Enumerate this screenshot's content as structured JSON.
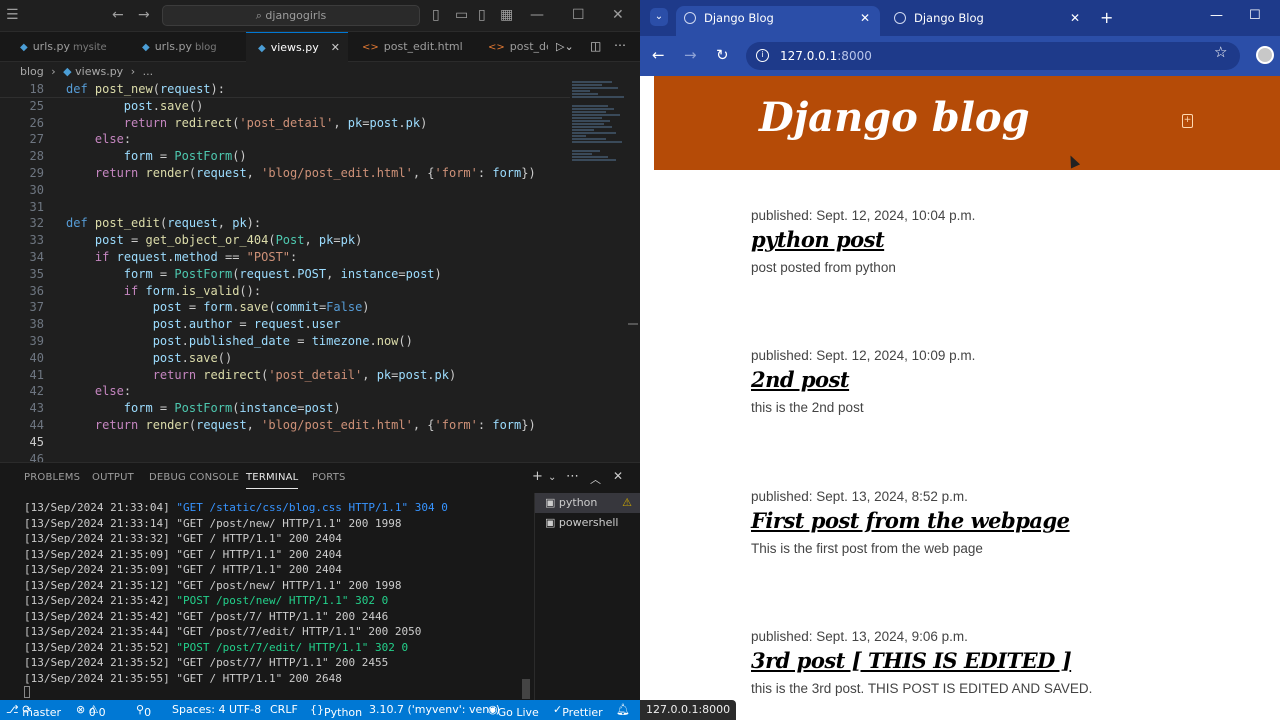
{
  "vscode": {
    "search_text": "djangogirls",
    "tabs": [
      {
        "label": "urls.py",
        "desc": "mysite",
        "type": "py"
      },
      {
        "label": "urls.py",
        "desc": "blog",
        "type": "py"
      },
      {
        "label": "views.py",
        "desc": "",
        "type": "py",
        "active": true
      },
      {
        "label": "post_edit.html",
        "desc": "",
        "type": "html"
      },
      {
        "label": "post_deta",
        "desc": "",
        "type": "html"
      }
    ],
    "breadcrumb": [
      "blog",
      "views.py",
      "..."
    ],
    "code": [
      {
        "n": "18",
        "html": "<span class=\"kw\">def</span> <span class=\"fn\">post_new</span>(<span class=\"var\">request</span>):"
      },
      {
        "n": "25",
        "html": "        <span class=\"var\">post</span>.<span class=\"fn\">save</span>()"
      },
      {
        "n": "26",
        "html": "        <span class=\"ctrl\">return</span> <span class=\"fn\">redirect</span>(<span class=\"str\">'post_detail'</span>, <span class=\"var\">pk</span>=<span class=\"var\">post</span>.<span class=\"var\">pk</span>)"
      },
      {
        "n": "27",
        "html": "    <span class=\"ctrl\">else</span>:"
      },
      {
        "n": "28",
        "html": "        <span class=\"var\">form</span> = <span class=\"cls\">PostForm</span>()"
      },
      {
        "n": "29",
        "html": "    <span class=\"ctrl\">return</span> <span class=\"fn\">render</span>(<span class=\"var\">request</span>, <span class=\"str\">'blog/post_edit.html'</span>, {<span class=\"str\">'form'</span>: <span class=\"var\">form</span>})"
      },
      {
        "n": "30",
        "html": ""
      },
      {
        "n": "31",
        "html": ""
      },
      {
        "n": "32",
        "html": "<span class=\"kw\">def</span> <span class=\"fn\">post_edit</span>(<span class=\"var\">request</span>, <span class=\"var\">pk</span>):"
      },
      {
        "n": "33",
        "html": "    <span class=\"var\">post</span> = <span class=\"fn\">get_object_or_404</span>(<span class=\"cls\">Post</span>, <span class=\"var\">pk</span>=<span class=\"var\">pk</span>)"
      },
      {
        "n": "34",
        "html": "    <span class=\"ctrl\">if</span> <span class=\"var\">request</span>.<span class=\"var\">method</span> == <span class=\"str\">\"POST\"</span>:"
      },
      {
        "n": "35",
        "html": "        <span class=\"var\">form</span> = <span class=\"cls\">PostForm</span>(<span class=\"var\">request</span>.<span class=\"var\">POST</span>, <span class=\"var\">instance</span>=<span class=\"var\">post</span>)"
      },
      {
        "n": "36",
        "html": "        <span class=\"ctrl\">if</span> <span class=\"var\">form</span>.<span class=\"fn\">is_valid</span>():"
      },
      {
        "n": "37",
        "html": "            <span class=\"var\">post</span> = <span class=\"var\">form</span>.<span class=\"fn\">save</span>(<span class=\"var\">commit</span>=<span class=\"lit\">False</span>)"
      },
      {
        "n": "38",
        "html": "            <span class=\"var\">post</span>.<span class=\"var\">author</span> = <span class=\"var\">request</span>.<span class=\"var\">user</span>"
      },
      {
        "n": "39",
        "html": "            <span class=\"var\">post</span>.<span class=\"var\">published_date</span> = <span class=\"var\">timezone</span>.<span class=\"fn\">now</span>()"
      },
      {
        "n": "40",
        "html": "            <span class=\"var\">post</span>.<span class=\"fn\">save</span>()"
      },
      {
        "n": "41",
        "html": "            <span class=\"ctrl\">return</span> <span class=\"fn\">redirect</span>(<span class=\"str\">'post_detail'</span>, <span class=\"var\">pk</span>=<span class=\"var\">post</span>.<span class=\"var\">pk</span>)"
      },
      {
        "n": "42",
        "html": "    <span class=\"ctrl\">else</span>:"
      },
      {
        "n": "43",
        "html": "        <span class=\"var\">form</span> = <span class=\"cls\">PostForm</span>(<span class=\"var\">instance</span>=<span class=\"var\">post</span>)"
      },
      {
        "n": "44",
        "html": "    <span class=\"ctrl\">return</span> <span class=\"fn\">render</span>(<span class=\"var\">request</span>, <span class=\"str\">'blog/post_edit.html'</span>, {<span class=\"str\">'form'</span>: <span class=\"var\">form</span>})"
      },
      {
        "n": "45",
        "html": "",
        "current": true
      },
      {
        "n": "46",
        "html": ""
      }
    ],
    "panel_tabs": [
      "PROBLEMS",
      "OUTPUT",
      "DEBUG CONSOLE",
      "TERMINAL",
      "PORTS"
    ],
    "active_panel_tab": "TERMINAL",
    "terminal": [
      {
        "ts": "[13/Sep/2024 21:33:04] ",
        "req": "\"GET /static/css/blog.css HTTP/1.1\" 304 0",
        "style": "hi"
      },
      {
        "ts": "[13/Sep/2024 21:33:14] ",
        "req": "\"GET /post/new/ HTTP/1.1\" 200 1998",
        "style": ""
      },
      {
        "ts": "[13/Sep/2024 21:33:32] ",
        "req": "\"GET / HTTP/1.1\" 200 2404",
        "style": ""
      },
      {
        "ts": "[13/Sep/2024 21:35:09] ",
        "req": "\"GET / HTTP/1.1\" 200 2404",
        "style": ""
      },
      {
        "ts": "[13/Sep/2024 21:35:09] ",
        "req": "\"GET / HTTP/1.1\" 200 2404",
        "style": ""
      },
      {
        "ts": "[13/Sep/2024 21:35:12] ",
        "req": "\"GET /post/new/ HTTP/1.1\" 200 1998",
        "style": ""
      },
      {
        "ts": "[13/Sep/2024 21:35:42] ",
        "req": "\"POST /post/new/ HTTP/1.1\" 302 0",
        "style": "gr"
      },
      {
        "ts": "[13/Sep/2024 21:35:42] ",
        "req": "\"GET /post/7/ HTTP/1.1\" 200 2446",
        "style": ""
      },
      {
        "ts": "[13/Sep/2024 21:35:44] ",
        "req": "\"GET /post/7/edit/ HTTP/1.1\" 200 2050",
        "style": ""
      },
      {
        "ts": "[13/Sep/2024 21:35:52] ",
        "req": "\"POST /post/7/edit/ HTTP/1.1\" 302 0",
        "style": "gr"
      },
      {
        "ts": "[13/Sep/2024 21:35:52] ",
        "req": "\"GET /post/7/ HTTP/1.1\" 200 2455",
        "style": ""
      },
      {
        "ts": "[13/Sep/2024 21:35:55] ",
        "req": "\"GET / HTTP/1.1\" 200 2648",
        "style": ""
      }
    ],
    "terminal_list": [
      {
        "label": "python",
        "active": true,
        "warn": true
      },
      {
        "label": "powershell",
        "active": false,
        "warn": false
      }
    ],
    "status": {
      "branch": "master",
      "errors": "0",
      "warnings": "0",
      "ports": "0",
      "spaces": "Spaces: 4",
      "encoding": "UTF-8",
      "eol": "CRLF",
      "language": "Python",
      "interpreter": "3.10.7 ('myvenv': venv)",
      "golive": "Go Live",
      "prettier": "Prettier"
    }
  },
  "chrome": {
    "tabs": [
      {
        "label": "Django Blog",
        "active": true
      },
      {
        "label": "Django Blog",
        "active": false
      }
    ],
    "url_host": "127.0.0.1",
    "url_port": ":8000",
    "status_url": "127.0.0.1:8000",
    "brand": "Django blog",
    "posts": [
      {
        "date": "published: Sept. 12, 2024, 10:04 p.m.",
        "title": "python post",
        "body": "post posted from python"
      },
      {
        "date": "published: Sept. 12, 2024, 10:09 p.m.",
        "title": "2nd post",
        "body": "this is the 2nd post"
      },
      {
        "date": "published: Sept. 13, 2024, 8:52 p.m.",
        "title": "First post from the webpage",
        "body": "This is the first post from the web page"
      },
      {
        "date": "published: Sept. 13, 2024, 9:06 p.m.",
        "title": "3rd post [ THIS IS EDITED ]",
        "body": "this is the 3rd post. THIS POST IS EDITED AND SAVED."
      }
    ]
  }
}
